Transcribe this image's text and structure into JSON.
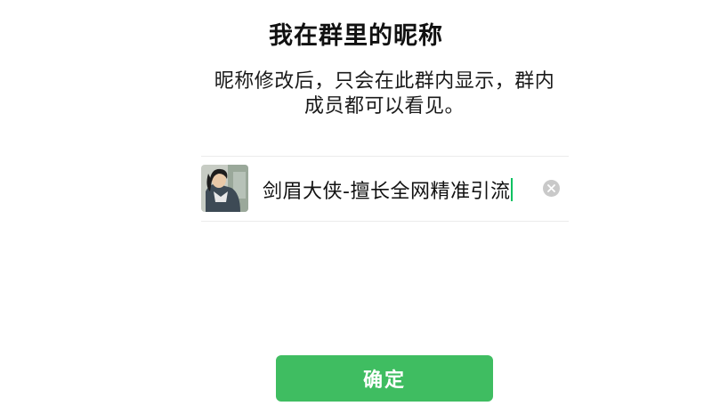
{
  "header": {
    "title": "我在群里的昵称"
  },
  "description": {
    "line1": "昵称修改后，只会在此群内显示，群内",
    "line2": "成员都可以看见。"
  },
  "nickname_field": {
    "value": "剑眉大侠-擅长全网精准引流",
    "avatar_icon": "user-avatar-photo",
    "clear_icon": "clear-icon"
  },
  "actions": {
    "confirm_label": "确定"
  },
  "colors": {
    "accent": "#3fbd61",
    "caret": "#07c160",
    "clear_bg": "#c9c9c9"
  }
}
